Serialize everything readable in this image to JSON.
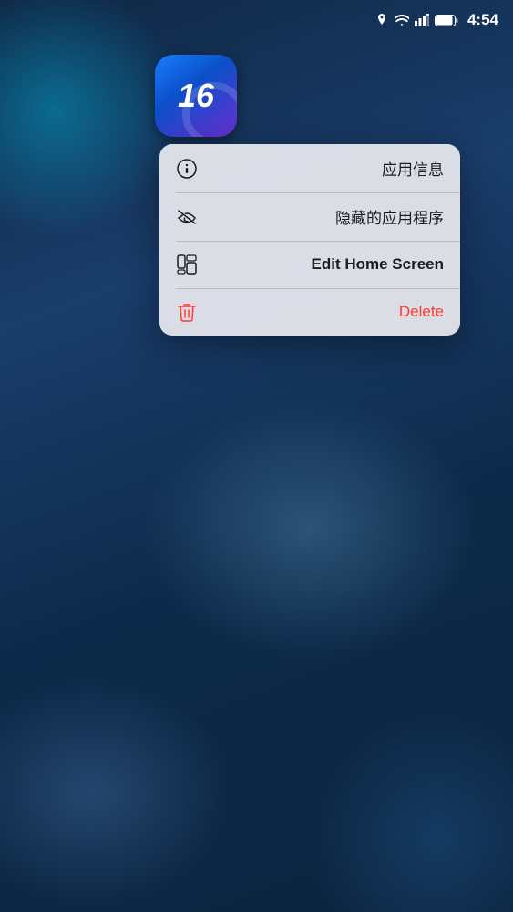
{
  "statusBar": {
    "time": "4:54",
    "icons": [
      "location",
      "wifi",
      "cellular",
      "battery"
    ]
  },
  "appIcon": {
    "number": "16",
    "altText": "iOS 16 App Icon"
  },
  "contextMenu": {
    "items": [
      {
        "id": "app-info",
        "label": "应用信息",
        "iconType": "info-circle",
        "labelColor": "normal",
        "fontWeight": "normal"
      },
      {
        "id": "hidden-apps",
        "label": "隐藏的应用程序",
        "iconType": "eye-slash",
        "labelColor": "normal",
        "fontWeight": "normal"
      },
      {
        "id": "edit-home-screen",
        "label": "Edit Home Screen",
        "iconType": "phone-grid",
        "labelColor": "normal",
        "fontWeight": "bold"
      },
      {
        "id": "delete",
        "label": "Delete",
        "iconType": "trash",
        "labelColor": "red",
        "fontWeight": "normal"
      }
    ]
  }
}
